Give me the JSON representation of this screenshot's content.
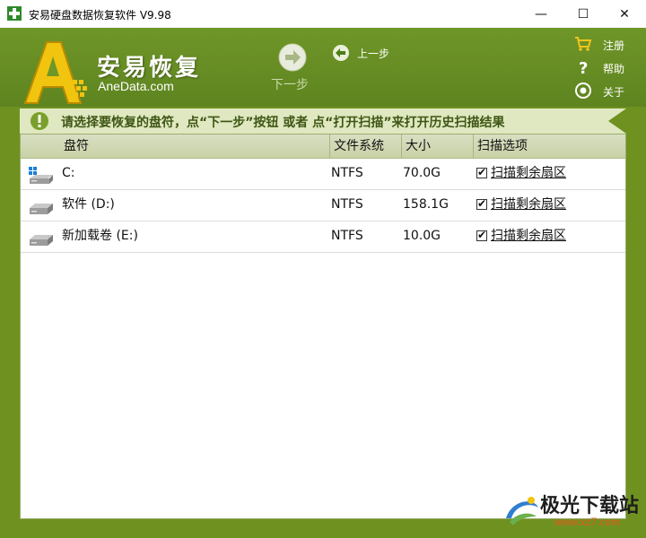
{
  "window": {
    "title": "安易硬盘数据恢复软件 V9.98",
    "minimize_glyph": "—",
    "maximize_glyph": "☐",
    "close_glyph": "✕"
  },
  "header": {
    "logo_text": "安易恢复",
    "logo_sub": "AneData.com",
    "next_label": "下一步",
    "prev_label": "上一步",
    "register_label": "注册",
    "help_label": "帮助",
    "about_label": "关于"
  },
  "hint": {
    "text": "请选择要恢复的盘符，点“下一步”按钮 或者 点“打开扫描”来打开历史扫描结果"
  },
  "table": {
    "columns": [
      "盘符",
      "文件系统",
      "大小",
      "扫描选项"
    ],
    "rows": [
      {
        "drive": "C:",
        "fs": "NTFS",
        "size": "70.0G",
        "option": "扫描剩余扇区",
        "checked": true,
        "icon": "windows-drive-icon"
      },
      {
        "drive": "软件 (D:)",
        "fs": "NTFS",
        "size": "158.1G",
        "option": "扫描剩余扇区",
        "checked": true,
        "icon": "hard-drive-icon"
      },
      {
        "drive": "新加载卷 (E:)",
        "fs": "NTFS",
        "size": "10.0G",
        "option": "扫描剩余扇区",
        "checked": true,
        "icon": "hard-drive-icon"
      }
    ]
  },
  "watermark": {
    "text": "极光下载站",
    "url": "www.xz7.com"
  },
  "colors": {
    "background": "#6f9120",
    "hint_bar": "#dfe8c0",
    "header_row": "#d0d7b2"
  }
}
